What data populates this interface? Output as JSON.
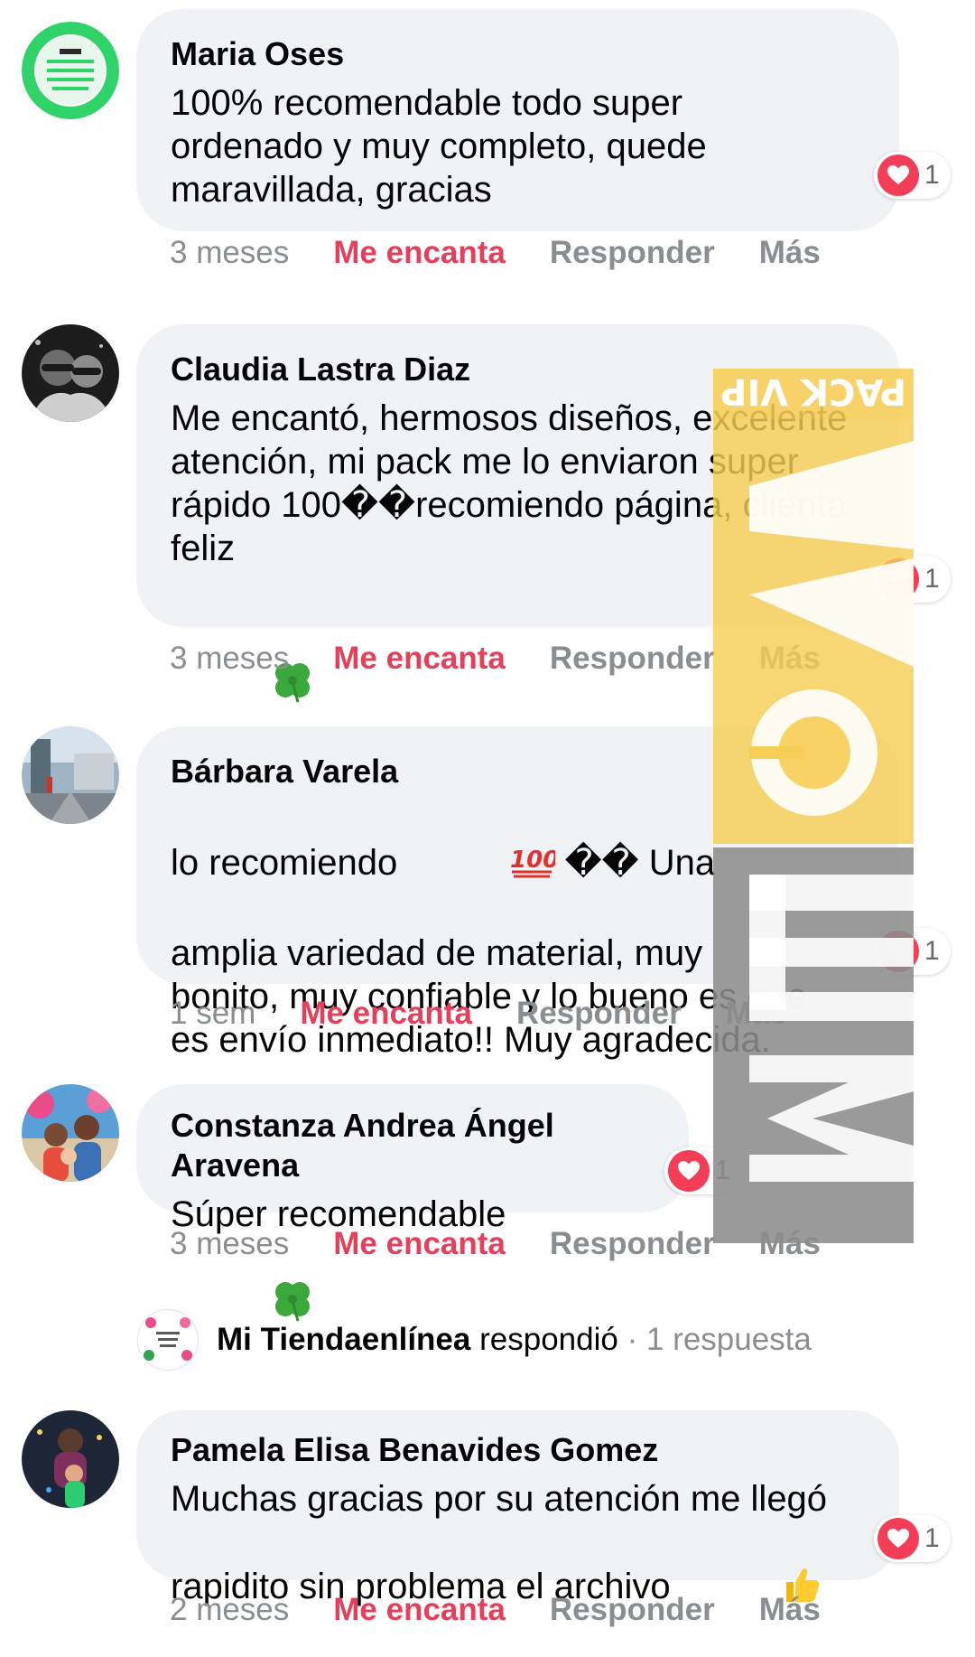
{
  "colors": {
    "bubble": "#f0f2f5",
    "love": "#e4405c",
    "muted": "#8a8d91",
    "heart": "#f33e58",
    "watermark_yellow": "#f7cd55",
    "watermark_gray": "#8c8c8c"
  },
  "comments": [
    {
      "author": "Maria Oses",
      "text": "100% recomendable todo super ordenado y muy completo, quede maravillada, gracias",
      "reaction_icon": "heart-icon",
      "reaction_count": "1",
      "time": "3 meses",
      "love_label": "Me encanta",
      "reply_label": "Responder",
      "more_label": "Más"
    },
    {
      "author": "Claudia Lastra Diaz",
      "text": "Me encantó, hermosos diseños, excelente atención, mi pack me lo enviaron super rápido 100��recomiendo página, clienta feliz",
      "emoji": "four-leaf-clover-icon",
      "reaction_icon": "heart-icon",
      "reaction_count": "1",
      "time": "3 meses",
      "love_label": "Me encanta",
      "reply_label": "Responder",
      "more_label": "Más"
    },
    {
      "author": "Bárbara Varela",
      "text_part1": "lo recomiendo",
      "emoji": "hundred-points-icon",
      "text_part2": "�� Una amplia variedad de material, muy bonito, muy confiable y lo bueno es que es envío inmediato!! Muy agradecida.",
      "reaction_icon": "heart-icon",
      "reaction_count": "1",
      "time": "1 sem",
      "love_label": "Me encanta",
      "reply_label": "Responder",
      "more_label": "Más"
    },
    {
      "author": "Constanza Andrea Ángel Aravena",
      "text": "Súper recomendable",
      "emoji": "four-leaf-clover-icon",
      "reaction_icon": "heart-icon",
      "reaction_count": "1",
      "time": "3 meses",
      "love_label": "Me encanta",
      "reply_label": "Responder",
      "more_label": "Más"
    },
    {
      "author": "Pamela Elisa Benavides Gomez",
      "text": "Muchas gracias por su atención me llegó rapidito sin problema el archivo",
      "emoji": "thumbs-up-icon",
      "reaction_icon": "heart-icon",
      "reaction_count": "1",
      "time": "2 meses",
      "love_label": "Me encanta",
      "reply_label": "Responder",
      "more_label": "Más"
    }
  ],
  "reply_thread": {
    "name": "Mi Tiendaenlínea",
    "verb": "respondió",
    "separator": "·",
    "count": "1 respuesta"
  },
  "avatar_text": {
    "maria": "SE REALIZA SERVICIO DE IMPRESIÓN FOTOCOPIAS PLASTIFICADO DE DOCUMENTOS ESCANEO"
  },
  "watermark": {
    "banner_text": "PACK VIP",
    "letters": "MECA"
  }
}
